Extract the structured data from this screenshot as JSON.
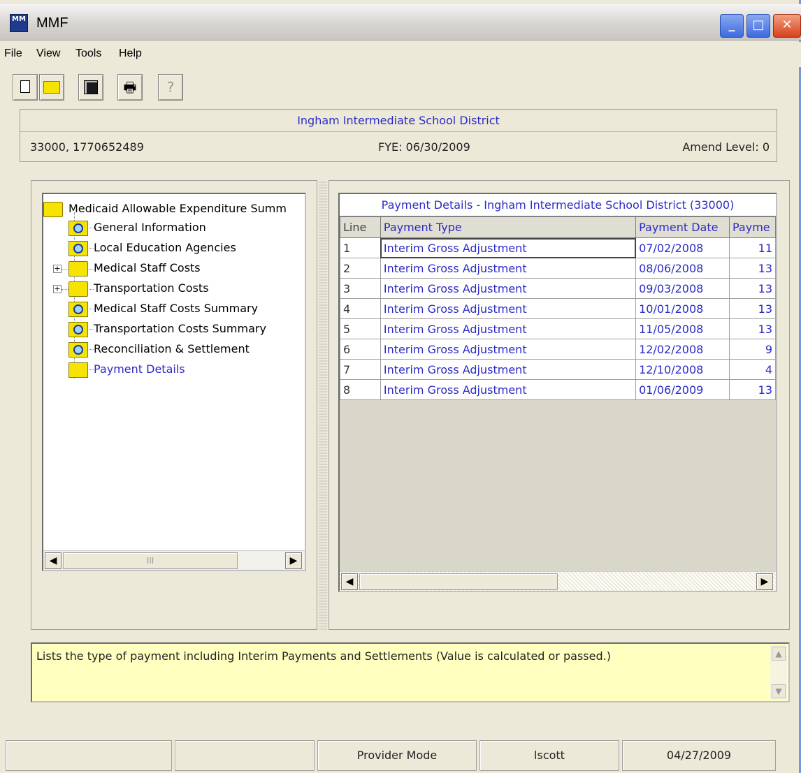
{
  "window": {
    "title": "MMF",
    "app_icon_text": "MM"
  },
  "menu": [
    "File",
    "View",
    "Tools",
    "Help"
  ],
  "toolbar": {
    "new": "new-document-icon",
    "open": "open-folder-icon",
    "save": "save-icon",
    "print": "print-icon",
    "help": "help-icon"
  },
  "header": {
    "title": "Ingham Intermediate School District",
    "ids": "33000, 1770652489",
    "fye": "FYE: 06/30/2009",
    "amend": "Amend Level: 0"
  },
  "tree": {
    "root": "Medicaid Allowable Expenditure Summ",
    "items": [
      {
        "label": "General Information",
        "icon": "magnifier-folder-icon"
      },
      {
        "label": "Local Education Agencies",
        "icon": "magnifier-folder-icon"
      },
      {
        "label": "Medical Staff Costs",
        "icon": "folder-icon"
      },
      {
        "label": "Transportation Costs",
        "icon": "folder-icon"
      },
      {
        "label": "Medical Staff Costs Summary",
        "icon": "magnifier-folder-icon"
      },
      {
        "label": "Transportation Costs Summary",
        "icon": "magnifier-folder-icon"
      },
      {
        "label": "Reconciliation & Settlement",
        "icon": "magnifier-folder-icon"
      },
      {
        "label": "Payment Details",
        "icon": "open-folder-icon"
      }
    ],
    "scroll_thumb": "III"
  },
  "grid": {
    "title": "Payment Details - Ingham Intermediate School District (33000)",
    "columns": [
      "Line",
      "Payment Type",
      "Payment Date",
      "Payme"
    ],
    "rows": [
      {
        "line": "1",
        "type": "Interim Gross Adjustment",
        "date": "07/02/2008",
        "amount": "11"
      },
      {
        "line": "2",
        "type": "Interim Gross Adjustment",
        "date": "08/06/2008",
        "amount": "13"
      },
      {
        "line": "3",
        "type": "Interim Gross Adjustment",
        "date": "09/03/2008",
        "amount": "13"
      },
      {
        "line": "4",
        "type": "Interim Gross Adjustment",
        "date": "10/01/2008",
        "amount": "13"
      },
      {
        "line": "5",
        "type": "Interim Gross Adjustment",
        "date": "11/05/2008",
        "amount": "13"
      },
      {
        "line": "6",
        "type": "Interim Gross Adjustment",
        "date": "12/02/2008",
        "amount": "9"
      },
      {
        "line": "7",
        "type": "Interim Gross Adjustment",
        "date": "12/10/2008",
        "amount": "4"
      },
      {
        "line": "8",
        "type": "Interim Gross Adjustment",
        "date": "01/06/2009",
        "amount": "13"
      }
    ]
  },
  "description": "Lists the type of payment including Interim Payments and Settlements (Value is calculated or passed.)",
  "status": {
    "panel1": "",
    "panel2": "",
    "mode": "Provider Mode",
    "user": "lscott",
    "date": "04/27/2009"
  },
  "colors": {
    "accent_text": "#2b2bc8",
    "description_bg": "#ffffc0",
    "window_bg": "#ece9d8"
  }
}
